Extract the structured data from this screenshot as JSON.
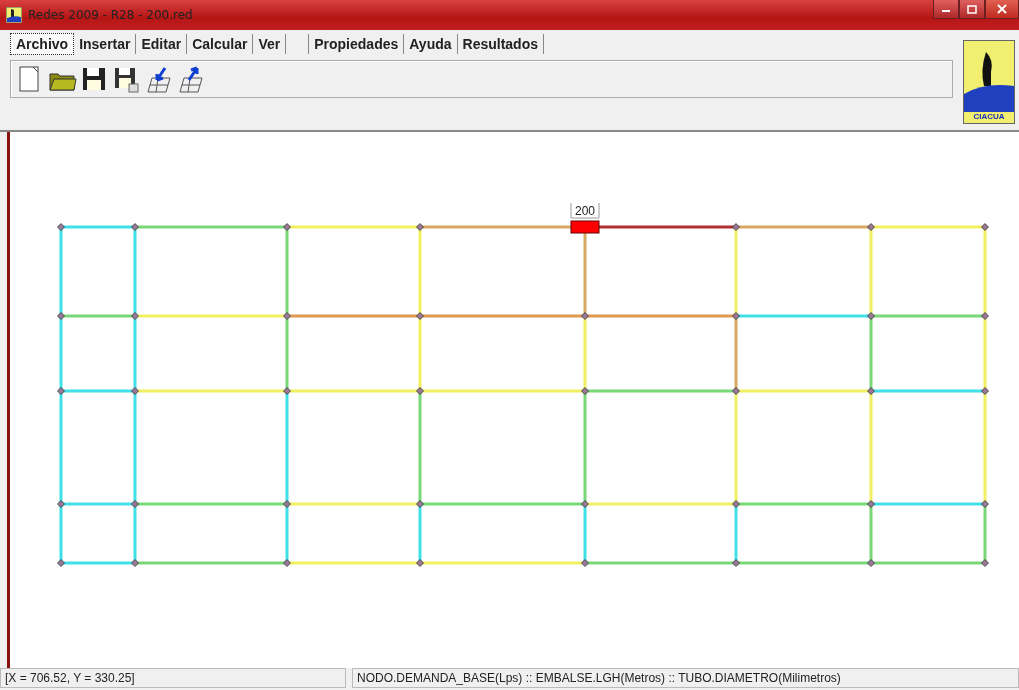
{
  "window": {
    "title": "Redes 2009  -  R28 - 200.red"
  },
  "menu": [
    {
      "label": "Archivo",
      "selected": true
    },
    {
      "label": "Insertar",
      "selected": false
    },
    {
      "label": "Editar",
      "selected": false
    },
    {
      "label": "Calcular",
      "selected": false
    },
    {
      "label": "Ver",
      "selected": false
    },
    {
      "label": "Propiedades",
      "selected": false
    },
    {
      "label": "Ayuda",
      "selected": false
    },
    {
      "label": "Resultados",
      "selected": false
    }
  ],
  "toolbar": [
    {
      "kind": "new"
    },
    {
      "kind": "open"
    },
    {
      "kind": "save"
    },
    {
      "kind": "saveas"
    },
    {
      "kind": "import"
    },
    {
      "kind": "export"
    }
  ],
  "logo": {
    "text": "CIACUA"
  },
  "network": {
    "reservoir": {
      "label": "200"
    },
    "pipes": [
      {
        "color": "#40e0e8"
      },
      {
        "color": "#78d878"
      },
      {
        "color": "#f0f060"
      },
      {
        "color": "#d8a860"
      },
      {
        "color": "#b03030"
      },
      {
        "color": "#d8a860"
      },
      {
        "color": "#f0f060"
      },
      {
        "color": "#78d878"
      },
      {
        "color": "#f0f060"
      },
      {
        "color": "#e09a50"
      },
      {
        "color": "#e09a50"
      },
      {
        "color": "#e09a50"
      },
      {
        "color": "#40e0e8"
      },
      {
        "color": "#78d878"
      },
      {
        "color": "#40e0e8"
      },
      {
        "color": "#f0f060"
      },
      {
        "color": "#f0f060"
      },
      {
        "color": "#f0f060"
      },
      {
        "color": "#78d878"
      },
      {
        "color": "#f0f060"
      },
      {
        "color": "#40e0e8"
      },
      {
        "color": "#40e0e8"
      },
      {
        "color": "#78d878"
      },
      {
        "color": "#f0f060"
      },
      {
        "color": "#78d878"
      },
      {
        "color": "#f0f060"
      },
      {
        "color": "#78d878"
      },
      {
        "color": "#40e0e8"
      },
      {
        "color": "#40e0e8"
      },
      {
        "color": "#78d878"
      },
      {
        "color": "#f0f060"
      },
      {
        "color": "#f0f060"
      },
      {
        "color": "#78d878"
      },
      {
        "color": "#78d878"
      },
      {
        "color": "#78d878"
      },
      {
        "color": "#40e0e8"
      },
      {
        "color": "#40e0e8"
      },
      {
        "color": "#40e0e8"
      },
      {
        "color": "#40e0e8"
      },
      {
        "color": "#40e0e8"
      },
      {
        "color": "#40e0e8"
      },
      {
        "color": "#40e0e8"
      },
      {
        "color": "#40e0e8"
      },
      {
        "color": "#78d878"
      },
      {
        "color": "#78d878"
      },
      {
        "color": "#40e0e8"
      },
      {
        "color": "#40e0e8"
      },
      {
        "color": "#f0f060"
      },
      {
        "color": "#f0f060"
      },
      {
        "color": "#78d878"
      },
      {
        "color": "#40e0e8"
      },
      {
        "color": "#d8a860"
      },
      {
        "color": "#f0f060"
      },
      {
        "color": "#78d878"
      },
      {
        "color": "#40e0e8"
      },
      {
        "color": "#f0f060"
      },
      {
        "color": "#d8a860"
      },
      {
        "color": "#f0f060"
      },
      {
        "color": "#40e0e8"
      },
      {
        "color": "#f0f060"
      },
      {
        "color": "#78d878"
      },
      {
        "color": "#f0f060"
      },
      {
        "color": "#78d878"
      },
      {
        "color": "#f0f060"
      },
      {
        "color": "#f0f060"
      },
      {
        "color": "#f0f060"
      },
      {
        "color": "#78d878"
      }
    ]
  },
  "status_bar": {
    "coordinates": "[X = 706.52, Y = 330.25]",
    "legend": "NODO.DEMANDA_BASE(Lps)  ::  EMBALSE.LGH(Metros)  ::  TUBO.DIAMETRO(Milimetros)"
  }
}
